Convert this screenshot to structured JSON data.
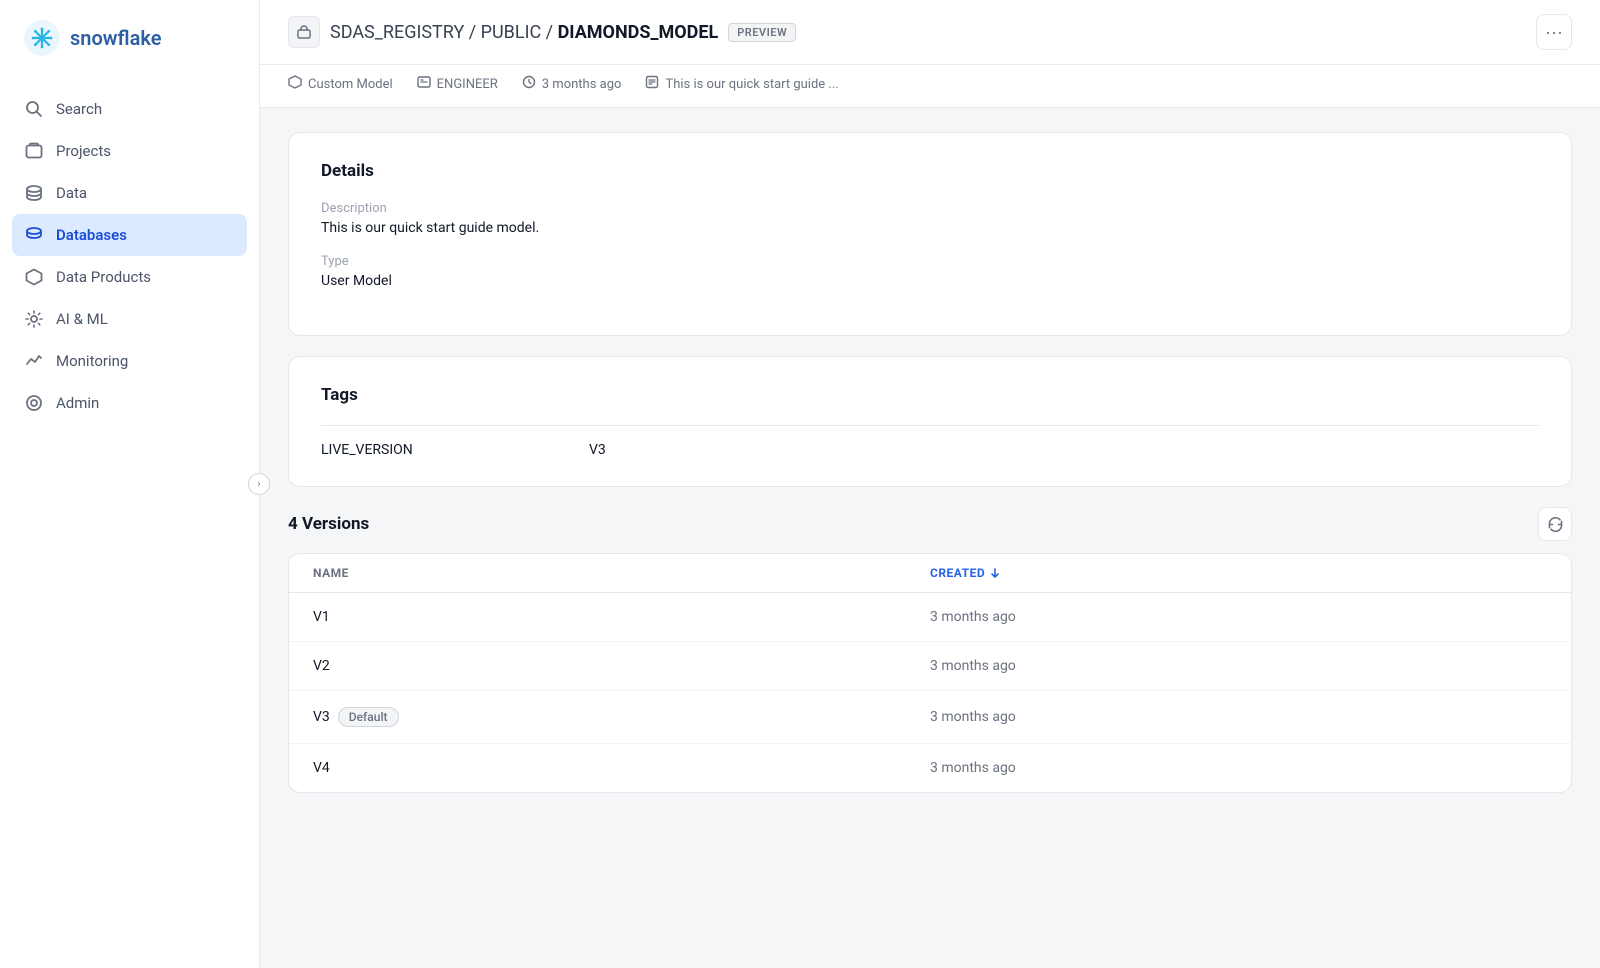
{
  "brand": {
    "name": "snowflake",
    "logo_alt": "Snowflake logo"
  },
  "sidebar": {
    "items": [
      {
        "id": "search",
        "label": "Search",
        "icon": "search"
      },
      {
        "id": "projects",
        "label": "Projects",
        "icon": "projects"
      },
      {
        "id": "data",
        "label": "Data",
        "icon": "data"
      },
      {
        "id": "databases",
        "label": "Databases",
        "icon": "databases",
        "active": true,
        "sub": true
      },
      {
        "id": "data-products",
        "label": "Data Products",
        "icon": "data-products"
      },
      {
        "id": "ai-ml",
        "label": "AI & ML",
        "icon": "ai"
      },
      {
        "id": "monitoring",
        "label": "Monitoring",
        "icon": "monitoring"
      },
      {
        "id": "admin",
        "label": "Admin",
        "icon": "admin"
      }
    ]
  },
  "header": {
    "breadcrumb_registry": "SDAS_REGISTRY",
    "breadcrumb_schema": "PUBLIC",
    "breadcrumb_model": "DIAMONDS_MODEL",
    "preview_label": "PREVIEW",
    "more_options_label": "···"
  },
  "meta": {
    "type_label": "Custom Model",
    "owner_label": "ENGINEER",
    "time_label": "3 months ago",
    "description_short": "This is our quick start guide ..."
  },
  "details_card": {
    "title": "Details",
    "description_label": "Description",
    "description_value": "This is our quick start guide model.",
    "type_label": "Type",
    "type_value": "User Model"
  },
  "tags_card": {
    "title": "Tags",
    "tags": [
      {
        "key": "LIVE_VERSION",
        "value": "V3"
      }
    ]
  },
  "versions_section": {
    "title": "4 Versions",
    "columns": [
      {
        "id": "name",
        "label": "NAME",
        "sortable": false
      },
      {
        "id": "created",
        "label": "CREATED",
        "sortable": true,
        "sort_dir": "desc"
      }
    ],
    "rows": [
      {
        "name": "V1",
        "created": "3 months ago",
        "default": false
      },
      {
        "name": "V2",
        "created": "3 months ago",
        "default": false
      },
      {
        "name": "V3",
        "created": "3 months ago",
        "default": true
      },
      {
        "name": "V4",
        "created": "3 months ago",
        "default": false
      }
    ],
    "default_label": "Default"
  }
}
